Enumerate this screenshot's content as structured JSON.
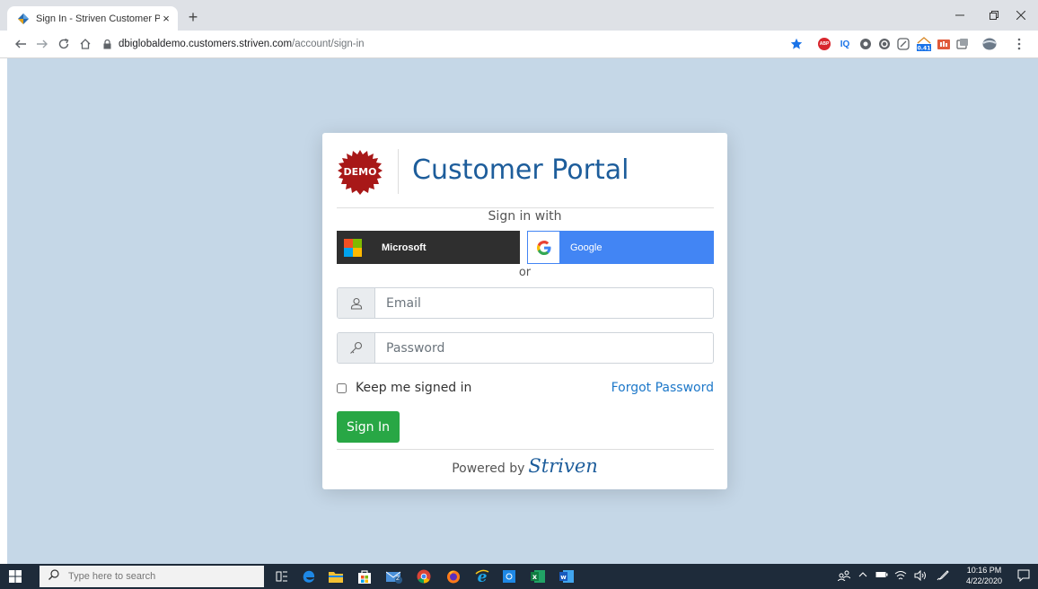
{
  "browser": {
    "tab_title": "Sign In - Striven Customer Portal",
    "tab_close": "×",
    "new_tab": "+",
    "url_host": "dbiglobaldemo.customers.striven.com",
    "url_path": "/account/sign-in",
    "ext_iq": "IQ",
    "ext_badge": "0.41",
    "ext_abp": "ABP"
  },
  "card": {
    "logo_text": "DEMO",
    "title": "Customer Portal",
    "sign_in_with": "Sign in with",
    "microsoft_label": "Microsoft",
    "google_label": "Google",
    "or_label": "or",
    "email_placeholder": "Email",
    "password_placeholder": "Password",
    "keep_signed_in": "Keep me signed in",
    "forgot_password": "Forgot Password",
    "sign_in_button": "Sign In",
    "powered_by": "Powered by",
    "brand": "Striven"
  },
  "taskbar": {
    "search_placeholder": "Type here to search",
    "mail_badge": "2",
    "time": "10:16 PM",
    "date": "4/22/2020"
  },
  "colors": {
    "page_bg": "#c5d7e7",
    "title_blue": "#1d5d9b",
    "sign_in_green": "#28a745",
    "google_blue": "#4285f4",
    "microsoft_dark": "#2f2f2f",
    "demo_red": "#a81818"
  }
}
